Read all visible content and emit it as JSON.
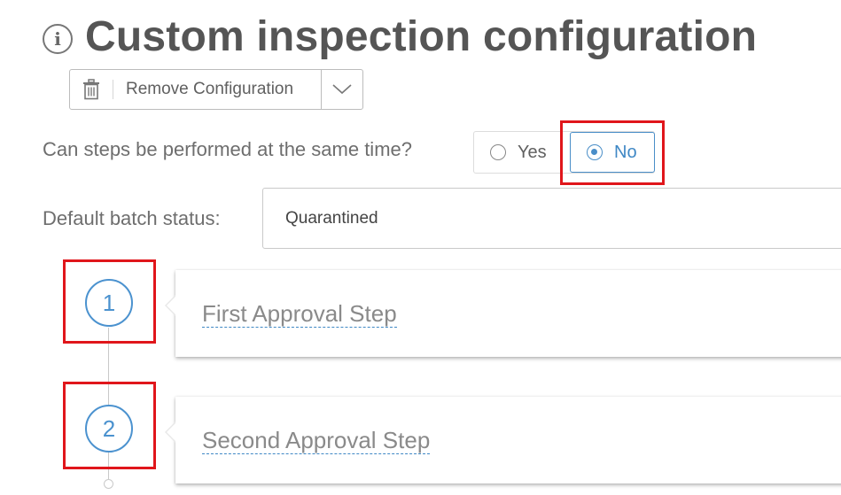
{
  "header": {
    "title": "Custom inspection configuration",
    "icon": "info-icon"
  },
  "toolbar": {
    "remove_label": "Remove Configuration",
    "remove_icon": "trash-icon",
    "dropdown_icon": "chevron-down-icon"
  },
  "concurrency": {
    "question": "Can steps be performed at the same time?",
    "options": [
      {
        "label": "Yes",
        "selected": false
      },
      {
        "label": "No",
        "selected": true
      }
    ]
  },
  "batch_status": {
    "label": "Default batch status:",
    "value": "Quarantined"
  },
  "steps": [
    {
      "number": "1",
      "title": "First Approval Step"
    },
    {
      "number": "2",
      "title": "Second Approval Step"
    }
  ],
  "colors": {
    "accent": "#4a8ec8",
    "highlight": "#e0161b",
    "text": "#555555"
  }
}
